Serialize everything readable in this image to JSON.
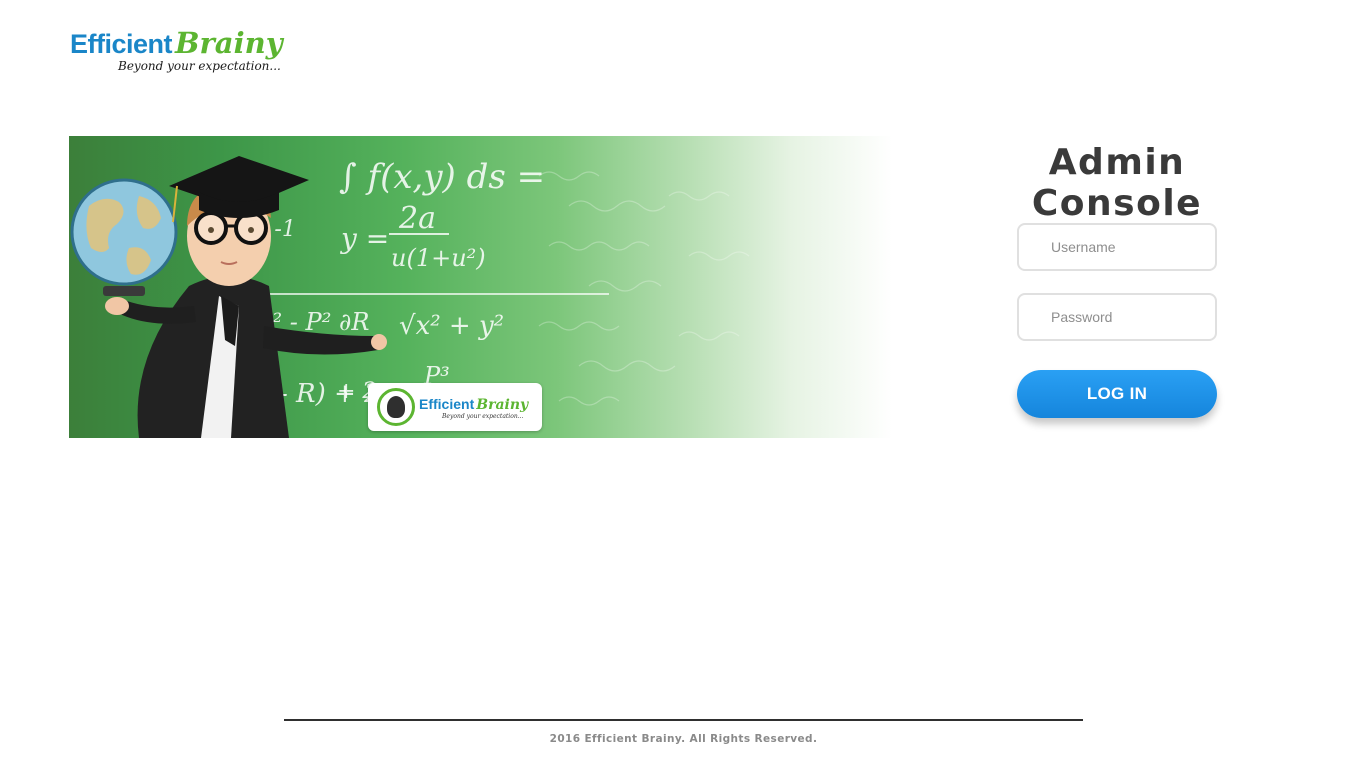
{
  "header": {
    "logo": {
      "word1": "Efficient",
      "word2": "Brainy",
      "tagline": "Beyond your expectation..."
    }
  },
  "banner": {
    "equations": [
      "∫ f(x,y) ds =",
      "2a",
      "y =",
      "u(1+u²)",
      "× -1",
      "√x² + y²",
      "y² - P² ∂R",
      "- R) + 2",
      "+ 2",
      "P³"
    ],
    "badge": {
      "word1": "Efficient",
      "word2": "Brainy",
      "tagline": "Beyond your expectation..."
    }
  },
  "login": {
    "title": "Admin Console",
    "username_placeholder": "Username",
    "password_placeholder": "Password",
    "button_label": "LOG IN"
  },
  "footer": {
    "copyright": "2016 Efficient Brainy. All Rights Reserved."
  },
  "colors": {
    "brand_blue": "#1a86c8",
    "brand_green": "#5cb531",
    "button_blue": "#1e90e8",
    "title_text": "#3a3a3a"
  }
}
